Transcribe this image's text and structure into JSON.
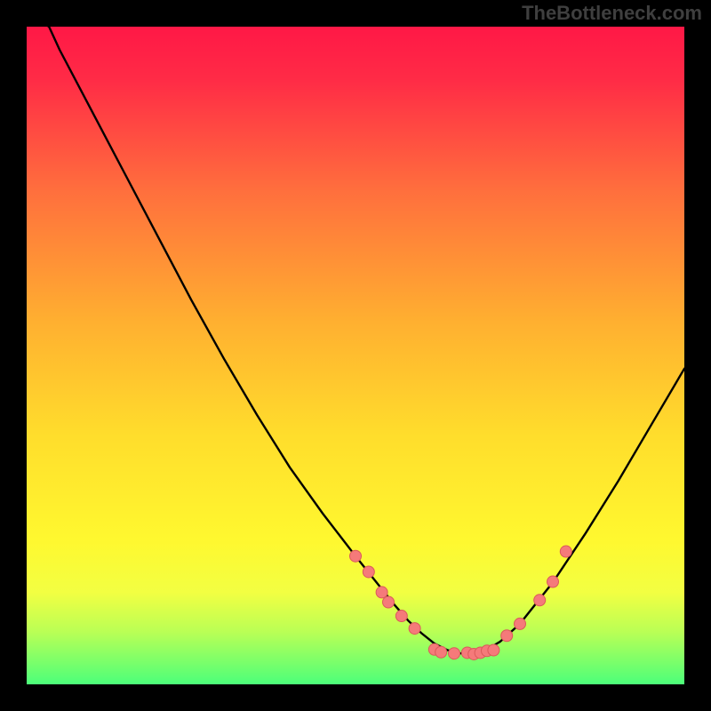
{
  "watermark": "TheBottleneck.com",
  "colors": {
    "gradient_top": "#ff1846",
    "gradient_mid": "#ffe329",
    "gradient_bottom": "#4cff7a",
    "curve": "#000000",
    "marker_fill": "#f57a7a",
    "marker_stroke": "#db5a5a"
  },
  "chart_data": {
    "type": "line",
    "title": "",
    "xlabel": "",
    "ylabel": "",
    "xlim": [
      0,
      100
    ],
    "ylim": [
      0,
      100
    ],
    "grid": false,
    "curve": {
      "x": [
        0,
        3.4,
        5,
        10,
        15,
        20,
        25,
        30,
        35,
        40,
        45,
        50,
        52,
        54,
        56,
        58,
        60,
        62,
        64,
        66,
        68,
        70,
        72,
        75,
        80,
        85,
        90,
        95,
        100
      ],
      "y": [
        102,
        100,
        96.5,
        87,
        77.5,
        68,
        58.5,
        49.5,
        41,
        33,
        26,
        19.5,
        17,
        14.5,
        12,
        9.7,
        7.8,
        6.2,
        5.2,
        4.7,
        4.7,
        5.3,
        6.5,
        9.2,
        15.5,
        23,
        31,
        39.5,
        48
      ]
    },
    "markers": [
      {
        "x": 50,
        "y": 19.5
      },
      {
        "x": 52,
        "y": 17.1
      },
      {
        "x": 54,
        "y": 14
      },
      {
        "x": 55,
        "y": 12.5
      },
      {
        "x": 57,
        "y": 10.4
      },
      {
        "x": 59,
        "y": 8.5
      },
      {
        "x": 62,
        "y": 5.3
      },
      {
        "x": 63,
        "y": 4.9
      },
      {
        "x": 65,
        "y": 4.7
      },
      {
        "x": 67,
        "y": 4.8
      },
      {
        "x": 68,
        "y": 4.6
      },
      {
        "x": 69,
        "y": 4.8
      },
      {
        "x": 70,
        "y": 5.1
      },
      {
        "x": 71,
        "y": 5.2
      },
      {
        "x": 73,
        "y": 7.4
      },
      {
        "x": 75,
        "y": 9.2
      },
      {
        "x": 78,
        "y": 12.8
      },
      {
        "x": 80,
        "y": 15.6
      },
      {
        "x": 82,
        "y": 20.2
      }
    ]
  }
}
